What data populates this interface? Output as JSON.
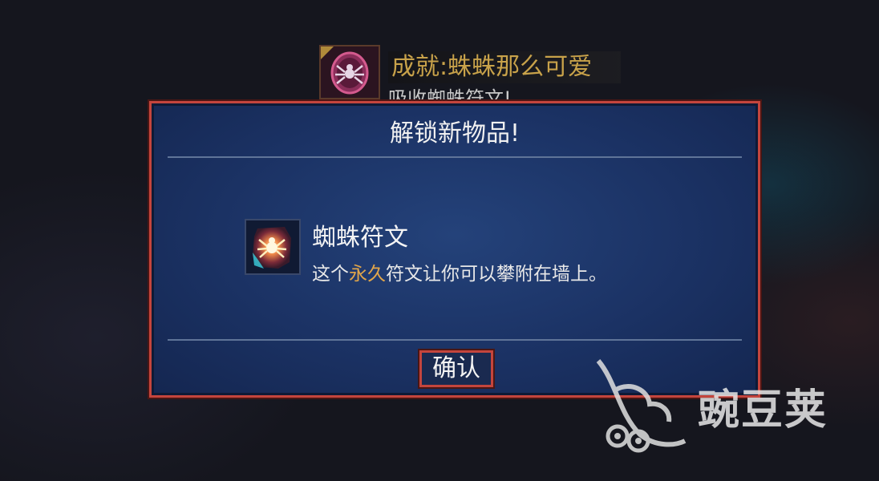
{
  "achievement": {
    "icon": "spider-badge-icon",
    "title": "成就:蛛蛛那么可爱",
    "description": "吸收蜘蛛符文!"
  },
  "dialog": {
    "title": "解锁新物品!",
    "item": {
      "icon": "spider-rune-icon",
      "name": "蜘蛛符文",
      "description_prefix": "这个",
      "description_highlight": "永久",
      "description_suffix": "符文让你可以攀附在墙上。"
    },
    "confirm_label": "确认"
  },
  "watermark": {
    "text": "豌豆荚",
    "icon": "wandoujia-logo-icon"
  },
  "colors": {
    "frame_red": "#c4453d",
    "panel_blue": "#1b3264",
    "highlight_orange": "#e2a64a",
    "achievement_gold": "#c8a24a"
  }
}
